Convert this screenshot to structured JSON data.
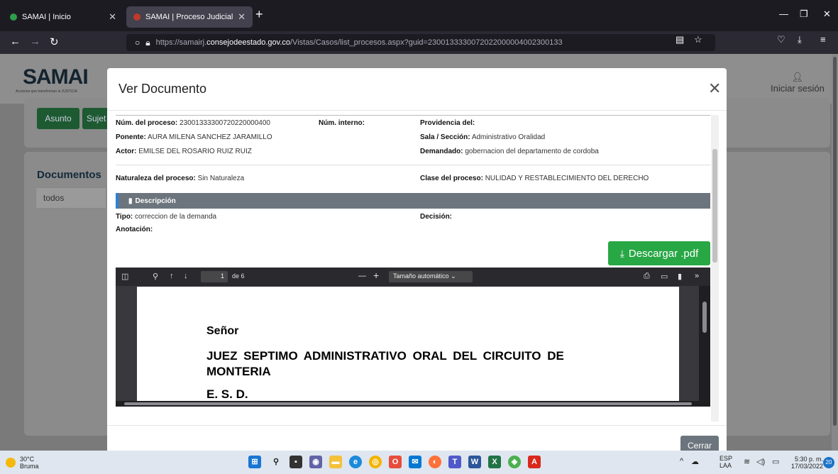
{
  "browser": {
    "tabs": [
      {
        "title": "SAMAI | Inicio",
        "active": false
      },
      {
        "title": "SAMAI | Proceso Judicial",
        "active": true
      }
    ],
    "new_tab": "+",
    "url_prefix": "https://samairj.",
    "url_host": "consejodeestado.gov.co",
    "url_path": "/Vistas/Casos/list_procesos.aspx?guid=2300133330072022000004002300133"
  },
  "page": {
    "logo_text": "SAMAI",
    "logo_sub": "Acciones que transforman la JUSTICIA",
    "login_label": "Iniciar sesión",
    "asunto_button": "Asunto",
    "sujetos_button": "Sujet",
    "documentos_title": "Documentos",
    "filter_value": "todos"
  },
  "modal": {
    "title": "Ver Documento",
    "fields": {
      "num_proceso_label": "Núm. del proceso:",
      "num_proceso_value": "23001333300720220000400",
      "num_interno_label": "Núm. interno:",
      "providencia_label": "Providencia del:",
      "ponente_label": "Ponente:",
      "ponente_value": "AURA MILENA SANCHEZ JARAMILLO",
      "sala_label": "Sala / Sección:",
      "sala_value": "Administrativo Oralidad",
      "actor_label": "Actor:",
      "actor_value": "EMILSE DEL ROSARIO RUIZ RUIZ",
      "demandado_label": "Demandado:",
      "demandado_value": "gobernacion del departamento de cordoba",
      "naturaleza_label": "Naturaleza del proceso:",
      "naturaleza_value": "Sin Naturaleza",
      "clase_label": "Clase del proceso:",
      "clase_value": "NULIDAD Y RESTABLECIMIENTO DEL DERECHO",
      "tipo_label": "Tipo:",
      "tipo_value": "correccion de la demanda",
      "decision_label": "Decisión:",
      "anotacion_label": "Anotación:"
    },
    "description_header": "Descripción",
    "download_button": "Descargar .pdf",
    "close_button": "Cerrar"
  },
  "pdf_viewer": {
    "current_page": "1",
    "page_total": "de 6",
    "zoom": "Tamaño automático",
    "document_lines": [
      "Señor",
      "JUEZ SEPTIMO ADMINISTRATIVO ORAL DEL CIRCUITO DE",
      "MONTERIA",
      "E. S. D."
    ]
  },
  "taskbar": {
    "temperature": "30°C",
    "weather": "Bruma",
    "lang_top": "ESP",
    "lang_bottom": "LAA",
    "time": "5:30 p. m.",
    "date": "17/03/2022",
    "notifications": "20"
  },
  "colors": {
    "success": "#28a745",
    "secondary": "#6c757d",
    "primary_accent": "#2a82d6"
  }
}
